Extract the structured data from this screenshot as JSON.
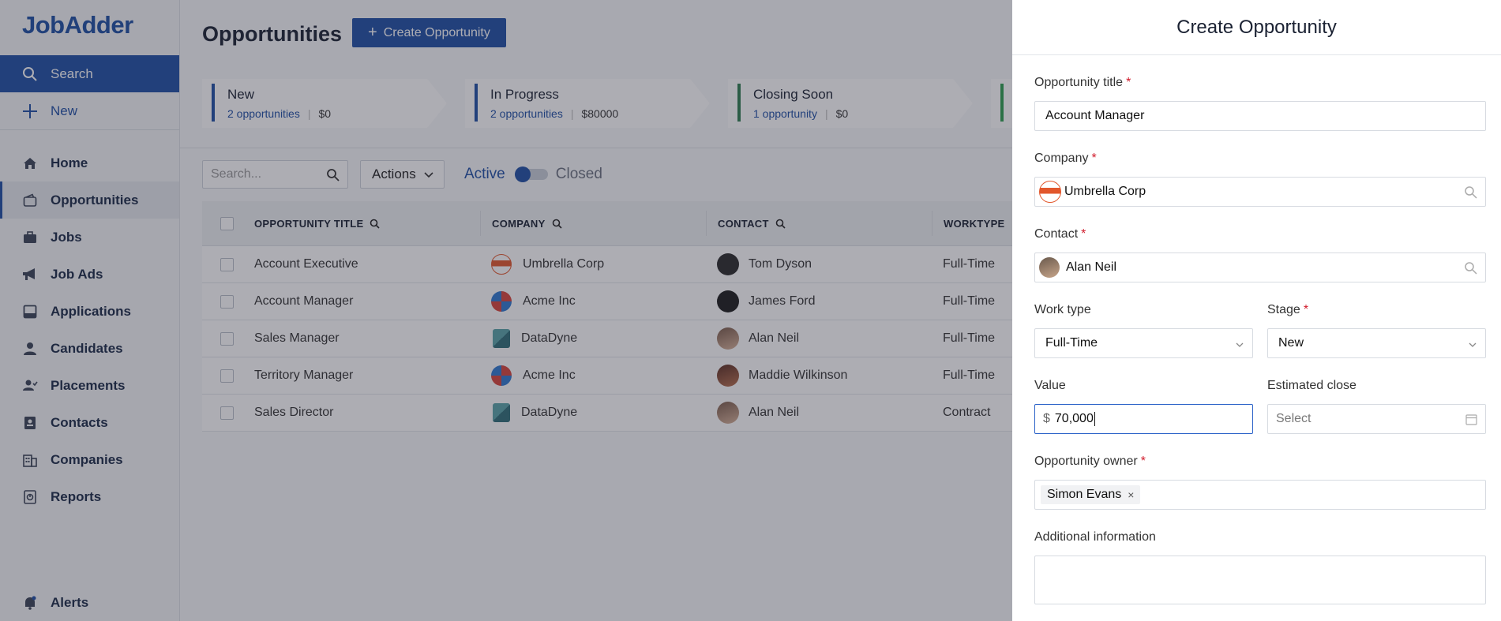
{
  "app": {
    "logo": "JobAdder"
  },
  "sidebar": {
    "top": [
      {
        "label": "Search",
        "icon": "search-icon"
      },
      {
        "label": "New",
        "icon": "plus-icon"
      }
    ],
    "items": [
      {
        "label": "Home",
        "icon": "home-icon"
      },
      {
        "label": "Opportunities",
        "icon": "wallet-icon"
      },
      {
        "label": "Jobs",
        "icon": "briefcase-icon"
      },
      {
        "label": "Job Ads",
        "icon": "megaphone-icon"
      },
      {
        "label": "Applications",
        "icon": "inbox-icon"
      },
      {
        "label": "Candidates",
        "icon": "person-icon"
      },
      {
        "label": "Placements",
        "icon": "person-check-icon"
      },
      {
        "label": "Contacts",
        "icon": "contact-card-icon"
      },
      {
        "label": "Companies",
        "icon": "building-icon"
      },
      {
        "label": "Reports",
        "icon": "report-icon"
      }
    ],
    "bottom": {
      "label": "Alerts",
      "icon": "bell-icon"
    }
  },
  "main": {
    "title": "Opportunities",
    "create_button": "Create Opportunity",
    "stages": [
      {
        "name": "New",
        "count": "2 opportunities",
        "value": "$0",
        "color": "#1f4fa5"
      },
      {
        "name": "In Progress",
        "count": "2 opportunities",
        "value": "$80000",
        "color": "#1f4fa5"
      },
      {
        "name": "Closing Soon",
        "count": "1 opportunity",
        "value": "$0",
        "color": "#2e7d4f"
      },
      {
        "name": "",
        "count": "",
        "value": "",
        "color": "#2e9e4f"
      }
    ],
    "search_placeholder": "Search...",
    "actions_label": "Actions",
    "toggle": {
      "active_label": "Active",
      "closed_label": "Closed"
    },
    "table": {
      "headers": {
        "title": "OPPORTUNITY TITLE",
        "company": "COMPANY",
        "contact": "CONTACT",
        "worktype": "WORKTYPE"
      },
      "rows": [
        {
          "title": "Account Executive",
          "company": "Umbrella Corp",
          "company_logo": "umbrella",
          "contact": "Tom Dyson",
          "worktype": "Full-Time"
        },
        {
          "title": "Account Manager",
          "company": "Acme Inc",
          "company_logo": "acme",
          "contact": "James Ford",
          "worktype": "Full-Time"
        },
        {
          "title": "Sales Manager",
          "company": "DataDyne",
          "company_logo": "datadyne",
          "contact": "Alan Neil",
          "worktype": "Full-Time"
        },
        {
          "title": "Territory Manager",
          "company": "Acme Inc",
          "company_logo": "acme",
          "contact": "Maddie Wilkinson",
          "worktype": "Full-Time"
        },
        {
          "title": "Sales Director",
          "company": "DataDyne",
          "company_logo": "datadyne",
          "contact": "Alan Neil",
          "worktype": "Contract"
        }
      ]
    }
  },
  "drawer": {
    "title": "Create Opportunity",
    "opportunity_title": {
      "label": "Opportunity title",
      "value": "Account Manager"
    },
    "company": {
      "label": "Company",
      "value": "Umbrella Corp"
    },
    "contact": {
      "label": "Contact",
      "value": "Alan Neil"
    },
    "work_type": {
      "label": "Work type",
      "value": "Full-Time"
    },
    "stage": {
      "label": "Stage",
      "value": "New"
    },
    "value": {
      "label": "Value",
      "prefix": "$",
      "value": "70,000"
    },
    "estimated_close": {
      "label": "Estimated close",
      "placeholder": "Select"
    },
    "owner": {
      "label": "Opportunity owner",
      "value": "Simon Evans"
    },
    "additional": {
      "label": "Additional information",
      "value": ""
    }
  },
  "colors": {
    "brand": "#1f4fa5",
    "required": "#d11a2a"
  }
}
